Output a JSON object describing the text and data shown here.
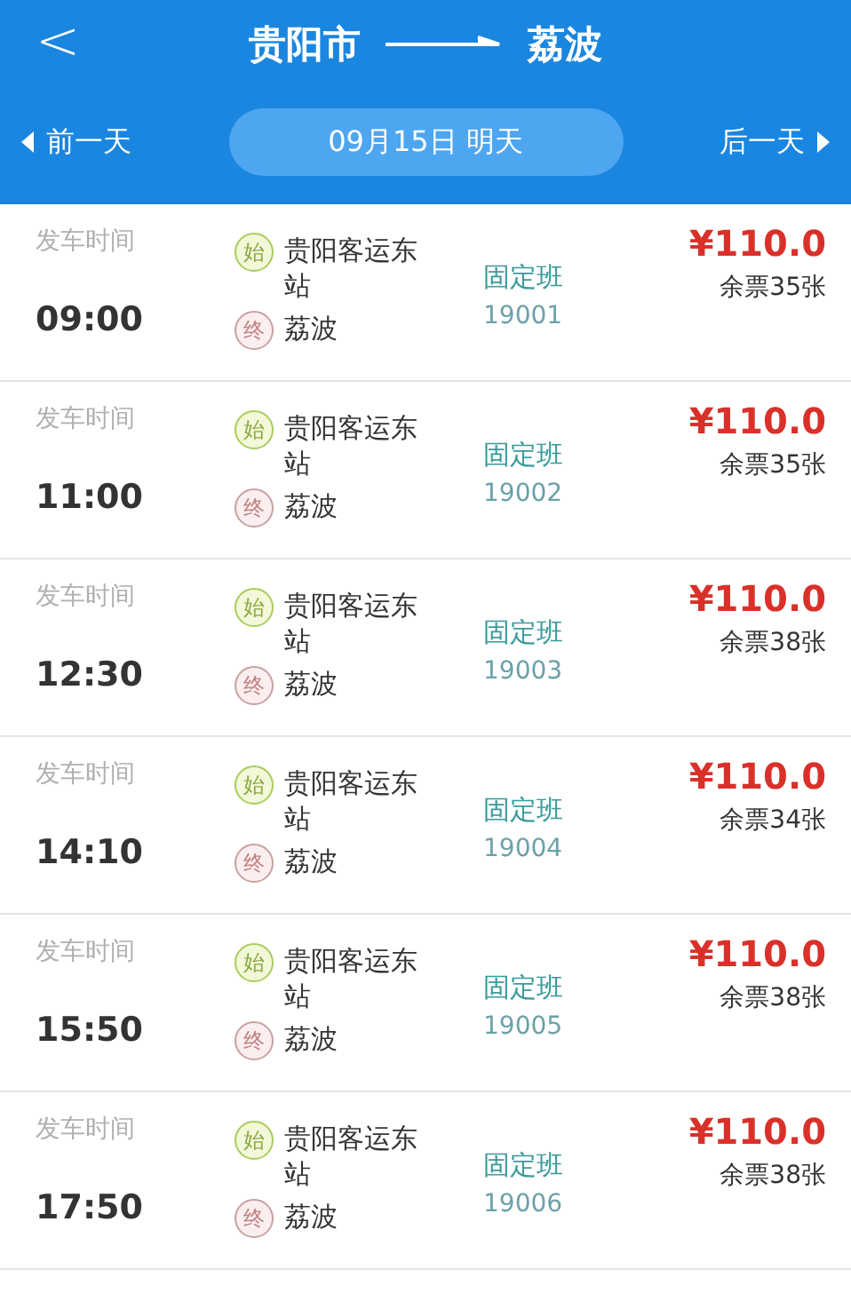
{
  "header": {
    "back": "<",
    "from": "贵阳市",
    "to": "荔波"
  },
  "date_bar": {
    "prev": "前一天",
    "current": "09月15日 明天",
    "next": "后一天"
  },
  "trips": [
    {
      "time_label": "发车时间",
      "time": "09:00",
      "start_badge": "始",
      "start": "贵阳客运东站",
      "end_badge": "终",
      "end": "荔波",
      "type": "固定班",
      "number": "19001",
      "price": "¥110.0",
      "seats": "余票35张"
    },
    {
      "time_label": "发车时间",
      "time": "11:00",
      "start_badge": "始",
      "start": "贵阳客运东站",
      "end_badge": "终",
      "end": "荔波",
      "type": "固定班",
      "number": "19002",
      "price": "¥110.0",
      "seats": "余票35张"
    },
    {
      "time_label": "发车时间",
      "time": "12:30",
      "start_badge": "始",
      "start": "贵阳客运东站",
      "end_badge": "终",
      "end": "荔波",
      "type": "固定班",
      "number": "19003",
      "price": "¥110.0",
      "seats": "余票38张"
    },
    {
      "time_label": "发车时间",
      "time": "14:10",
      "start_badge": "始",
      "start": "贵阳客运东站",
      "end_badge": "终",
      "end": "荔波",
      "type": "固定班",
      "number": "19004",
      "price": "¥110.0",
      "seats": "余票34张"
    },
    {
      "time_label": "发车时间",
      "time": "15:50",
      "start_badge": "始",
      "start": "贵阳客运东站",
      "end_badge": "终",
      "end": "荔波",
      "type": "固定班",
      "number": "19005",
      "price": "¥110.0",
      "seats": "余票38张"
    },
    {
      "time_label": "发车时间",
      "time": "17:50",
      "start_badge": "始",
      "start": "贵阳客运东站",
      "end_badge": "终",
      "end": "荔波",
      "type": "固定班",
      "number": "19006",
      "price": "¥110.0",
      "seats": "余票38张"
    }
  ]
}
